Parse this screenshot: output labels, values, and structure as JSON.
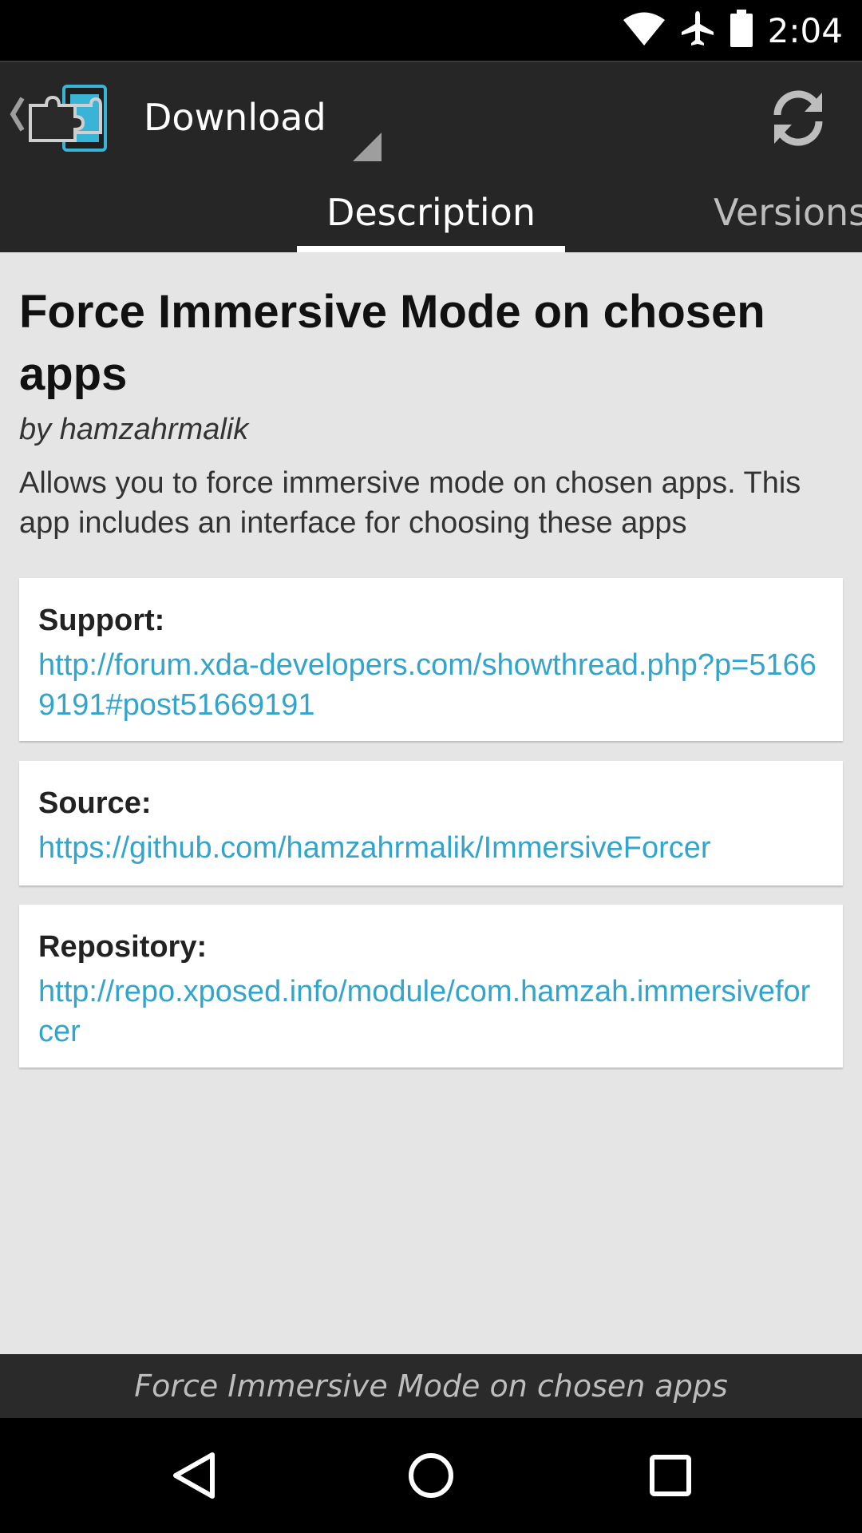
{
  "status_bar": {
    "time": "2:04",
    "icons": [
      "wifi-icon",
      "airplane-icon",
      "battery-icon"
    ]
  },
  "action_bar": {
    "title": "Download",
    "icons": [
      "back-chevron-icon",
      "xposed-logo-icon",
      "refresh-icon"
    ]
  },
  "tabs": [
    {
      "label": "Description",
      "selected": true
    },
    {
      "label": "Versions",
      "selected": false
    }
  ],
  "module": {
    "title": "Force Immersive Mode on chosen apps",
    "author": "by hamzahrmalik",
    "description": "Allows you to force immersive mode on chosen apps. This app includes an interface for choosing these apps"
  },
  "cards": {
    "support": {
      "label": "Support:",
      "link": "http://forum.xda-developers.com/showthread.php?p=51669191#post51669191"
    },
    "source": {
      "label": "Source:",
      "link": "https://github.com/hamzahrmalik/ImmersiveForcer"
    },
    "repository": {
      "label": "Repository:",
      "link": "http://repo.xposed.info/module/com.hamzah.immersiveforcer"
    }
  },
  "footer": {
    "text": "Force Immersive Mode on chosen apps"
  },
  "colors": {
    "link": "#33a5cc",
    "appbar": "#262626",
    "background": "#e5e5e5"
  }
}
